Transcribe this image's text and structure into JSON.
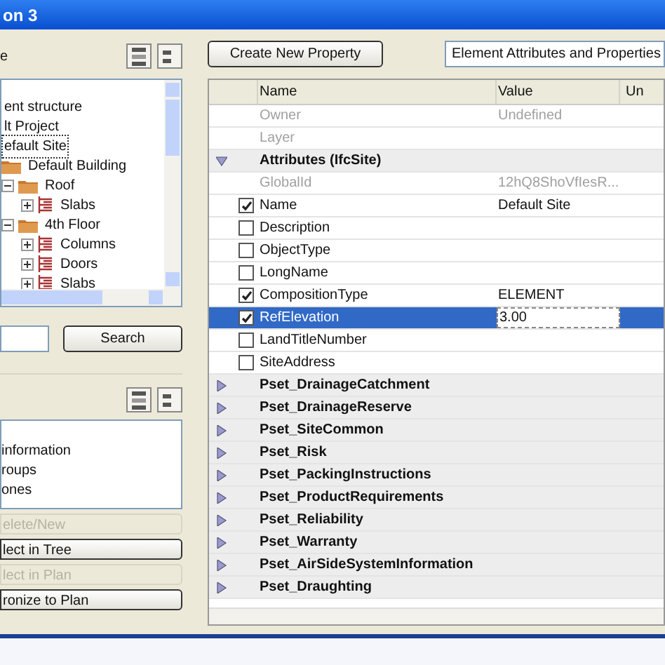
{
  "window": {
    "title": "on 3"
  },
  "left": {
    "tree_label": "e",
    "tree": [
      {
        "label": "ent structure",
        "children": [
          {
            "label": "lt Project",
            "children": [
              {
                "label": "efault Site",
                "selected": true,
                "children": [
                  {
                    "label": "Default Building",
                    "selected": false,
                    "children": [
                      {
                        "label": "Roof",
                        "expanded": true,
                        "selected": false,
                        "children": [
                          {
                            "label": "Slabs",
                            "expanded": false,
                            "selected": false
                          }
                        ]
                      },
                      {
                        "label": "4th Floor",
                        "expanded": true,
                        "selected": false,
                        "children": [
                          {
                            "label": "Columns",
                            "expanded": false,
                            "selected": false
                          },
                          {
                            "label": "Doors",
                            "expanded": false,
                            "selected": false
                          },
                          {
                            "label": "Slabs",
                            "expanded": false,
                            "selected": false
                          }
                        ]
                      }
                    ]
                  }
                ]
              }
            ]
          }
        ]
      }
    ],
    "search_button": "Search",
    "list": [
      "information",
      "roups",
      "ones"
    ],
    "buttons": [
      {
        "label": "elete/New",
        "disabled": true
      },
      {
        "label": "lect in Tree",
        "disabled": false
      },
      {
        "label": "lect in Plan",
        "disabled": true
      },
      {
        "label": "ronize to Plan",
        "disabled": false
      }
    ]
  },
  "right": {
    "create_button": "Create New Property",
    "view_select": "Element Attributes and Properties",
    "columns": [
      "Name",
      "Value",
      "Un"
    ],
    "rows": [
      {
        "kind": "info",
        "name": "Owner",
        "value": "Undefined",
        "selected": false
      },
      {
        "kind": "info",
        "name": "Layer",
        "selected": false
      },
      {
        "kind": "group",
        "name": "Attributes (IfcSite)",
        "expanded": true,
        "selected": false
      },
      {
        "kind": "info",
        "name": "GlobalId",
        "value": "12hQ8ShoVfIesR...",
        "selected": false
      },
      {
        "kind": "attr",
        "name": "Name",
        "value": "Default Site",
        "checked": true,
        "selected": false
      },
      {
        "kind": "attr",
        "name": "Description",
        "checked": false,
        "selected": false
      },
      {
        "kind": "attr",
        "name": "ObjectType",
        "checked": false,
        "selected": false
      },
      {
        "kind": "attr",
        "name": "LongName",
        "checked": false,
        "selected": false
      },
      {
        "kind": "attr",
        "name": "CompositionType",
        "value": "ELEMENT",
        "checked": true,
        "selected": false
      },
      {
        "kind": "attr",
        "name": "RefElevation",
        "value": "3.00",
        "checked": true,
        "selected": true
      },
      {
        "kind": "attr",
        "name": "LandTitleNumber",
        "checked": false,
        "selected": false
      },
      {
        "kind": "attr",
        "name": "SiteAddress",
        "checked": false,
        "selected": false
      },
      {
        "kind": "group",
        "name": "Pset_DrainageCatchment",
        "expanded": false,
        "selected": false
      },
      {
        "kind": "group",
        "name": "Pset_DrainageReserve",
        "expanded": false,
        "selected": false
      },
      {
        "kind": "group",
        "name": "Pset_SiteCommon",
        "expanded": false,
        "selected": false
      },
      {
        "kind": "group",
        "name": "Pset_Risk",
        "expanded": false,
        "selected": false
      },
      {
        "kind": "group",
        "name": "Pset_PackingInstructions",
        "expanded": false,
        "selected": false
      },
      {
        "kind": "group",
        "name": "Pset_ProductRequirements",
        "expanded": false,
        "selected": false
      },
      {
        "kind": "group",
        "name": "Pset_Reliability",
        "expanded": false,
        "selected": false
      },
      {
        "kind": "group",
        "name": "Pset_Warranty",
        "expanded": false,
        "selected": false
      },
      {
        "kind": "group",
        "name": "Pset_AirSideSystemInformation",
        "expanded": false,
        "selected": false
      },
      {
        "kind": "group",
        "name": "Pset_Draughting",
        "expanded": false,
        "selected": false
      }
    ]
  }
}
